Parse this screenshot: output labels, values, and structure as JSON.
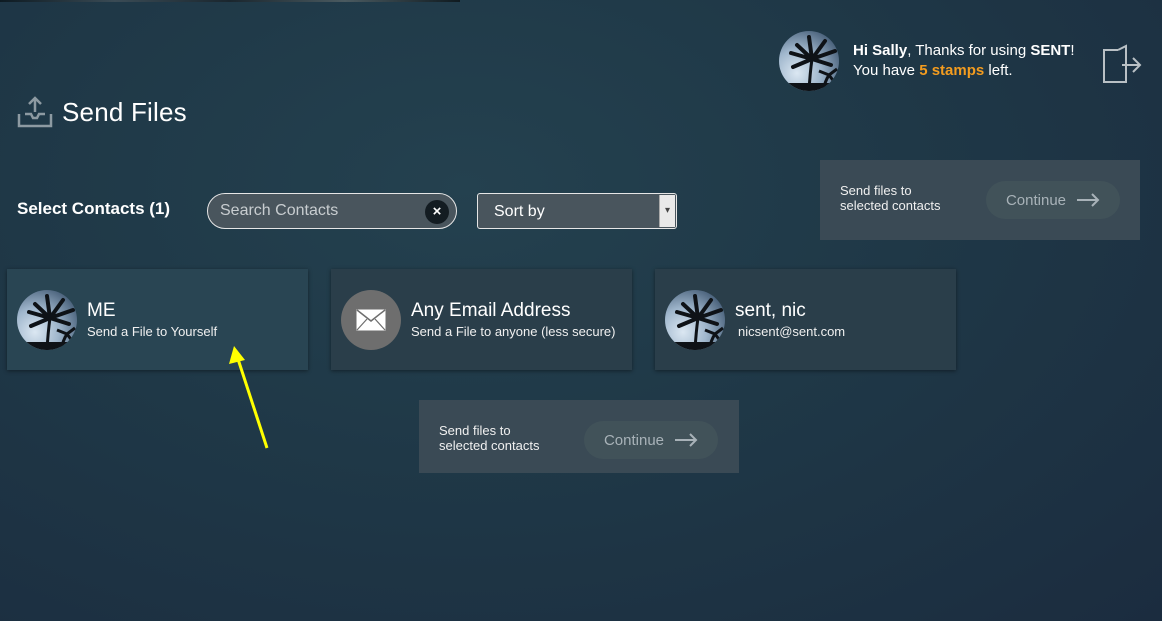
{
  "header": {
    "greeting_name": "Hi Sally",
    "greeting_rest": ", Thanks for using ",
    "brand": "SENT",
    "greeting_end": "!",
    "stamps_prefix": "You have ",
    "stamps": "5 stamps",
    "stamps_suffix": " left."
  },
  "page": {
    "title": "Send Files"
  },
  "contacts": {
    "select_label": "Select Contacts (1)",
    "search_placeholder": "Search Contacts",
    "clear_symbol": "×",
    "sort_label": "Sort by",
    "sort_arrow": "▾"
  },
  "send_panel": {
    "text_line1": "Send files to",
    "text_line2": "selected contacts",
    "continue_label": "Continue"
  },
  "cards": [
    {
      "name": "ME",
      "sub": "Send a File to Yourself",
      "avatar": "palm-tree-photo",
      "selected": true
    },
    {
      "name": "Any Email Address",
      "sub": "Send a File to anyone (less secure)",
      "avatar": "envelope-icon",
      "selected": false
    },
    {
      "name": "sent, nic",
      "sub": "nicsent@sent.com",
      "avatar": "palm-tree-photo",
      "selected": false
    }
  ],
  "colors": {
    "accent_orange": "#f39c1f",
    "annotation_arrow": "#ffff00",
    "panel_bg": "#3a4a55"
  },
  "icons": [
    "upload-icon",
    "logout-icon",
    "clear-search-icon",
    "arrow-right-icon",
    "envelope-icon",
    "annotation-arrow"
  ]
}
